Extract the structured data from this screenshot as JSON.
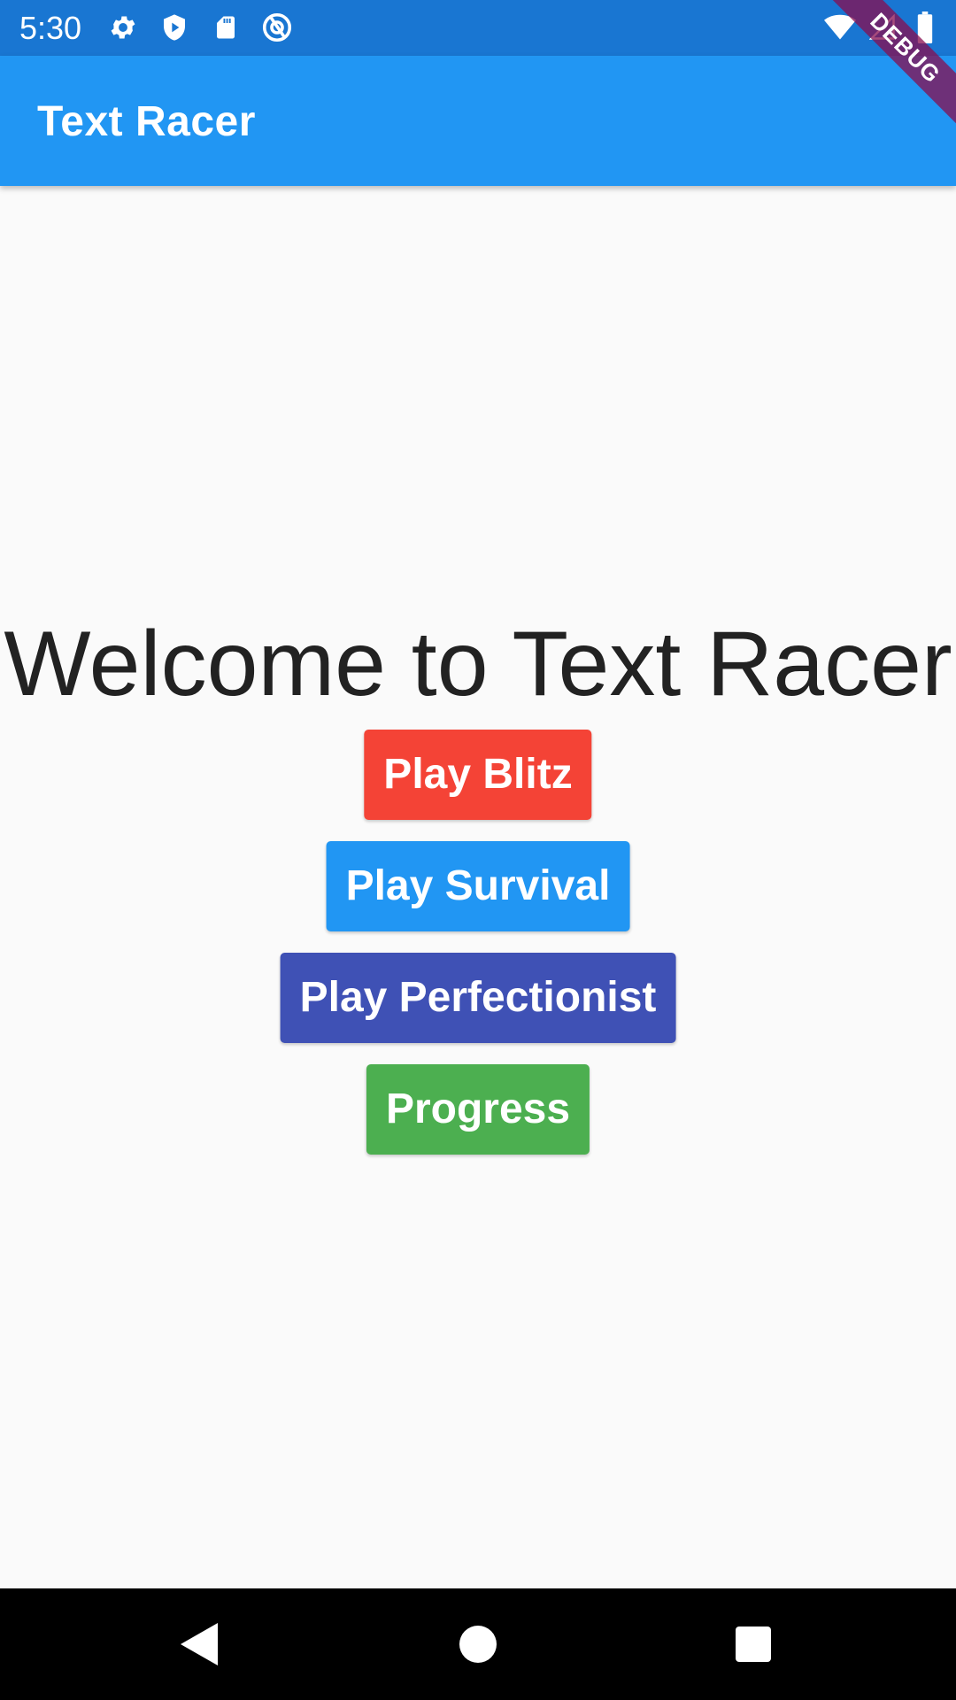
{
  "status_bar": {
    "time": "5:30",
    "left_icons": [
      "settings-icon",
      "shield-play-icon",
      "sd-card-icon",
      "at-sign-icon"
    ],
    "right_icons": [
      "wifi-icon",
      "signal-icon",
      "battery-icon"
    ],
    "color": "#1976d2"
  },
  "app_bar": {
    "title": "Text Racer",
    "color": "#2196f3"
  },
  "debug_banner": {
    "label": "DEBUG"
  },
  "main": {
    "welcome_text": "Welcome to Text Racer",
    "buttons": [
      {
        "label": "Play Blitz",
        "color": "#f44336"
      },
      {
        "label": "Play Survival",
        "color": "#2196f3"
      },
      {
        "label": "Play Perfectionist",
        "color": "#3f51b5"
      },
      {
        "label": "Progress",
        "color": "#4caf50"
      }
    ]
  },
  "nav_bar": {
    "icons": [
      "back-icon",
      "home-icon",
      "recents-icon"
    ]
  }
}
